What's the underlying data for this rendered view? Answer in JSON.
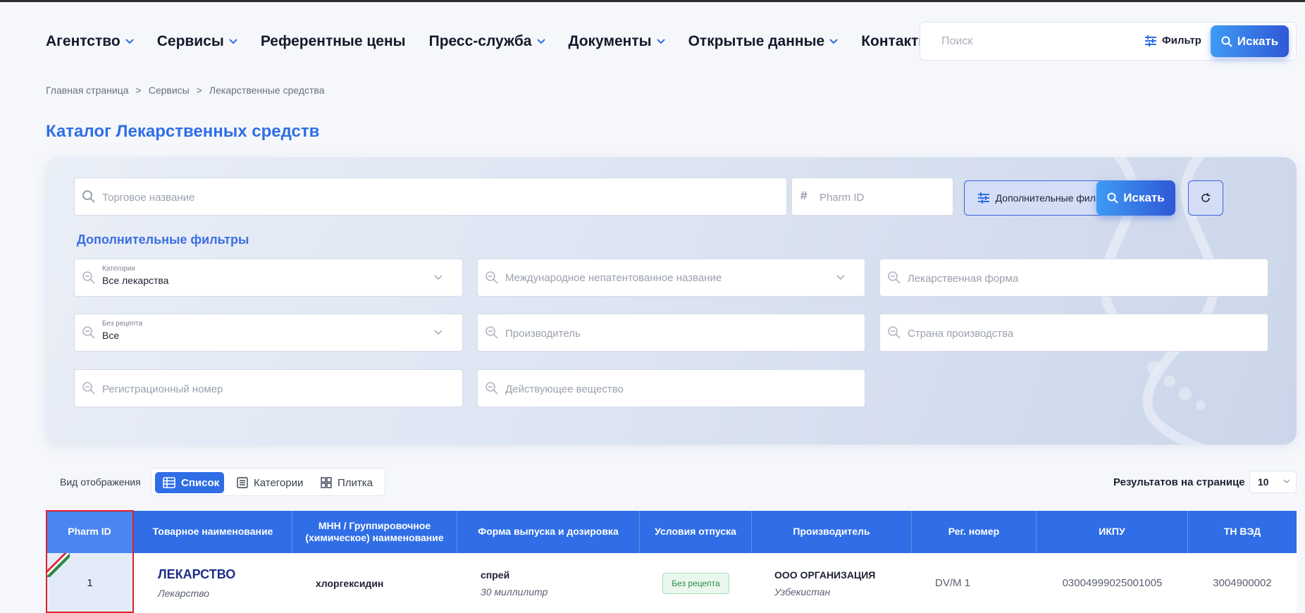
{
  "nav": {
    "items": [
      {
        "label": "Агентство",
        "dropdown": true
      },
      {
        "label": "Сервисы",
        "dropdown": true
      },
      {
        "label": "Референтные цены",
        "dropdown": false
      },
      {
        "label": "Пресс-служба",
        "dropdown": true
      },
      {
        "label": "Документы",
        "dropdown": true
      },
      {
        "label": "Открытые данные",
        "dropdown": true
      },
      {
        "label": "Контакты",
        "dropdown": true
      }
    ],
    "search_placeholder": "Поиск",
    "filter_label": "Фильтр",
    "search_button": "Искать"
  },
  "breadcrumb": {
    "items": [
      "Главная страница",
      "Сервисы",
      "Лекарственные средства"
    ],
    "separator": ">"
  },
  "page_title": "Каталог Лекарственных средств",
  "filters": {
    "trade_name_placeholder": "Торговое название",
    "pharm_id_symbol": "#",
    "pharm_id_placeholder": "Pharm ID",
    "more_filters_button": "Дополнительные фильтры",
    "search_button": "Искать",
    "advanced_title": "Дополнительные фильтры",
    "category": {
      "label": "Категория",
      "value": "Все лекарства"
    },
    "inn_placeholder": "Международное непатентованное название",
    "dosage_form_placeholder": "Лекарственная форма",
    "otc": {
      "label": "Без рецепта",
      "value": "Все"
    },
    "manufacturer_placeholder": "Производитель",
    "country_placeholder": "Страна производства",
    "reg_number_placeholder": "Регистрационный номер",
    "active_substance_placeholder": "Действующее вещество"
  },
  "view": {
    "label": "Вид отображения",
    "options": [
      "Список",
      "Категории",
      "Плитка"
    ],
    "active": "Список"
  },
  "per_page": {
    "label": "Результатов на странице",
    "value": "10"
  },
  "table": {
    "headers": [
      "Pharm ID",
      "Товарное наименование",
      "МНН / Группировочное (химическое) наименование",
      "Форма выпуска и дозировка",
      "Условия отпуска",
      "Производитель",
      "Рег. номер",
      "ИКПУ",
      "ТН ВЭД"
    ],
    "rows": [
      {
        "pharm_id": "1",
        "name": "ЛЕКАРСТВО",
        "name_sub": "Лекарство",
        "inn": "хлоргексидин",
        "form": "спрей",
        "dosage": "30 миллилитр",
        "dispense": "Без рецепта",
        "manufacturer": "ООО ОРГАНИЗАЦИЯ",
        "country": "Узбекистан",
        "reg_number": "DV/M 1",
        "ikpu": "03004999025001005",
        "tn_ved": "3004900002"
      }
    ]
  },
  "colors": {
    "accent": "#2f6ee6",
    "header_bg": "#2f6ee6",
    "badge_green": "#2d8a48",
    "highlight_red": "#e0202a"
  }
}
